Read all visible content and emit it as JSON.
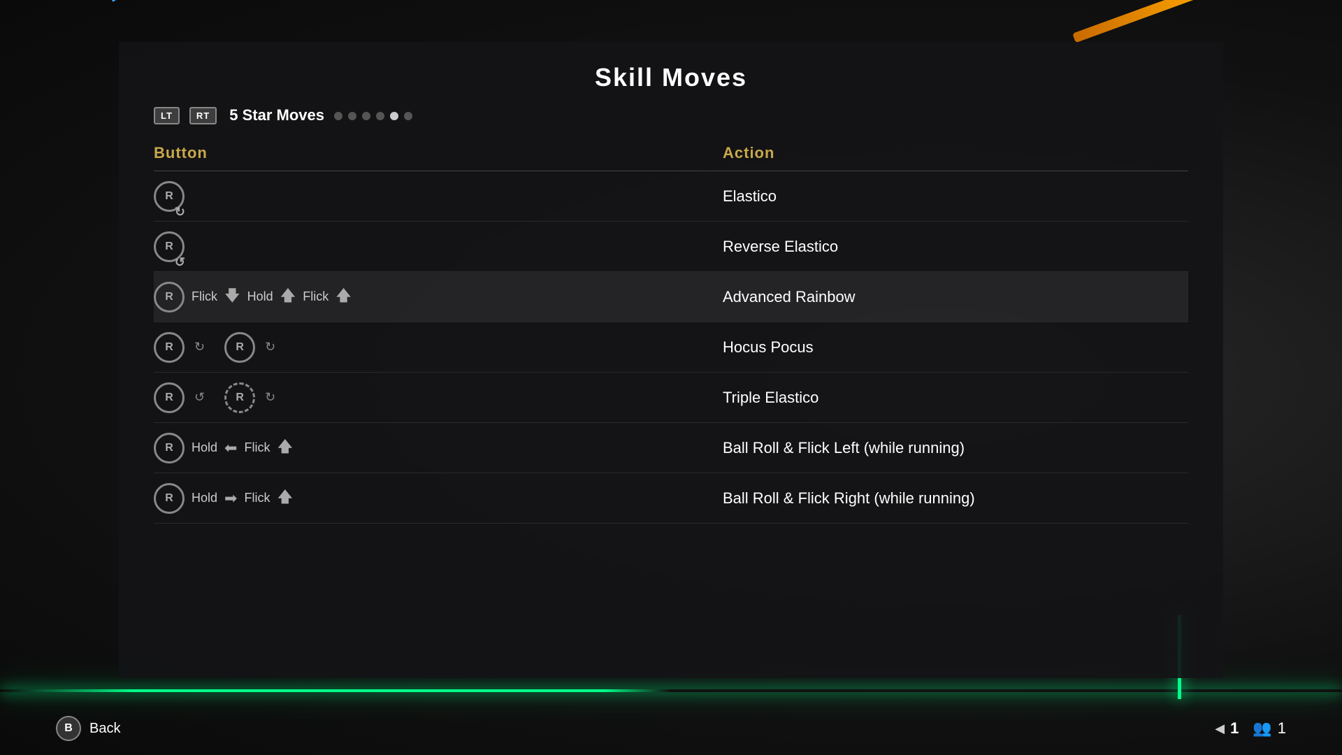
{
  "page": {
    "title": "Skill Moves",
    "bg_color": "#141416"
  },
  "nav": {
    "lt_label": "LT",
    "rt_label": "RT",
    "category_label": "5 Star Moves",
    "tabs_count": 6,
    "active_tab": 4
  },
  "columns": {
    "button_header": "Button",
    "action_header": "Action"
  },
  "moves": [
    {
      "id": 0,
      "button_desc": "R rotate-cw",
      "button_display": "R rotate-cw",
      "action": "Elastico",
      "selected": false
    },
    {
      "id": 1,
      "button_desc": "R rotate-ccw",
      "button_display": "R rotate-ccw",
      "action": "Reverse Elastico",
      "selected": false
    },
    {
      "id": 2,
      "button_desc": "R Flick Down Hold Up Flick Up",
      "button_display": "R  Flick ↓  Hold ↑  Flick ↑",
      "action": "Advanced Rainbow",
      "selected": true,
      "parts": [
        "R",
        "Flick",
        "down-arrow",
        "Hold",
        "up-arrow",
        "Flick",
        "up-arrow"
      ]
    },
    {
      "id": 3,
      "button_desc": "R R double",
      "button_display": "R rotate-cw  R rotate-cw",
      "action": "Hocus Pocus",
      "selected": false
    },
    {
      "id": 4,
      "button_desc": "R rotate-ccw  R rotate-cw-dashed",
      "button_display": "R rotate-ccw  R rotate-cw-dashed",
      "action": "Triple Elastico",
      "selected": false
    },
    {
      "id": 5,
      "button_desc": "R Hold left Flick up",
      "button_display": "R  Hold ←  Flick ↑",
      "action": "Ball Roll & Flick Left (while running)",
      "selected": false,
      "parts": [
        "R",
        "Hold",
        "left-arrow",
        "Flick",
        "up-arrow"
      ]
    },
    {
      "id": 6,
      "button_desc": "R Hold right Flick up",
      "button_display": "R  Hold →  Flick ↑",
      "action": "Ball Roll & Flick Right (while running)",
      "selected": false,
      "parts": [
        "R",
        "Hold",
        "right-arrow",
        "Flick",
        "up-arrow"
      ]
    }
  ],
  "bottom": {
    "back_button_label": "B",
    "back_label": "Back",
    "page_number": "1",
    "player_count": "1"
  }
}
